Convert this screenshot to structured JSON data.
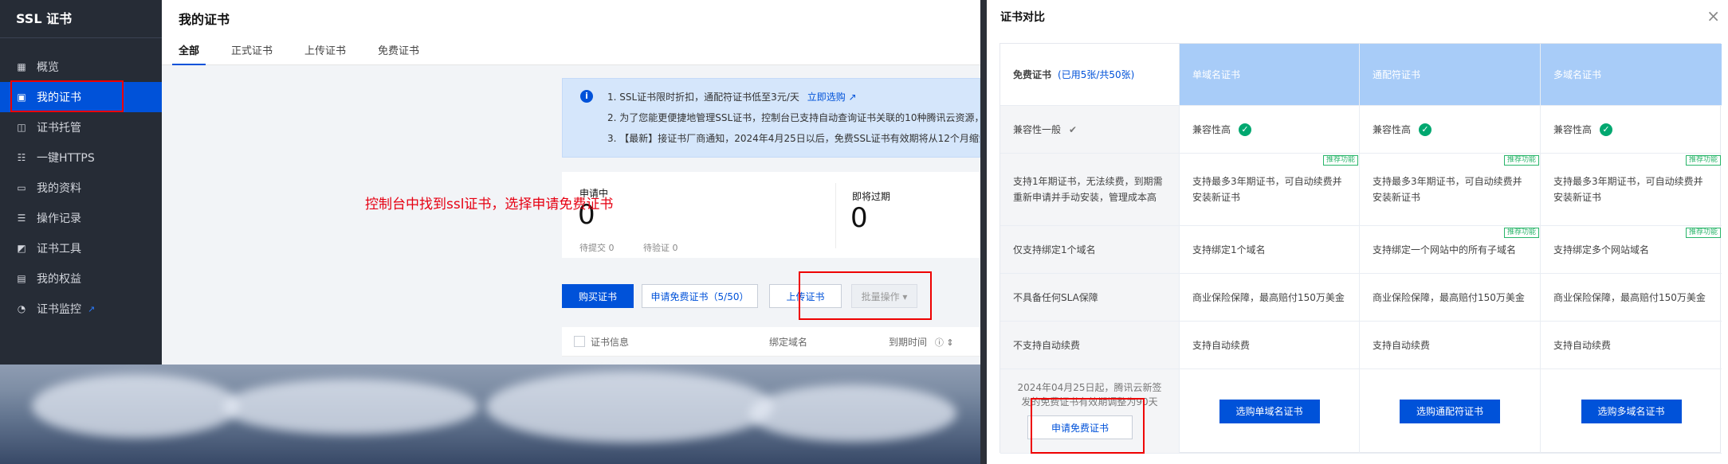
{
  "left": {
    "sidebar": {
      "brand": "SSL 证书",
      "items": [
        {
          "label": "概览",
          "icon": "grid-icon"
        },
        {
          "label": "我的证书",
          "icon": "document-icon"
        },
        {
          "label": "证书托管",
          "icon": "shield-icon"
        },
        {
          "label": "一键HTTPS",
          "icon": "bars-icon"
        },
        {
          "label": "我的资料",
          "icon": "folder-icon"
        },
        {
          "label": "操作记录",
          "icon": "list-icon"
        },
        {
          "label": "证书工具",
          "icon": "tool-icon"
        },
        {
          "label": "我的权益",
          "icon": "calendar-icon"
        },
        {
          "label": "证书监控",
          "icon": "monitor-icon",
          "external": "↗"
        }
      ]
    },
    "header": {
      "title": "我的证书",
      "tabs": [
        "全部",
        "正式证书",
        "上传证书",
        "免费证书"
      ]
    },
    "notice": {
      "lines": [
        "1. SSL证书限时折扣，通配符证书低至3元/天",
        "2. 为了您能更便捷地管理SSL证书，控制台已支持自动查询证书关联的10种腾讯云资源，",
        "3. 【最新】接证书厂商通知，2024年4月25日以后，免费SSL证书有效期将从12个月缩短至"
      ],
      "link": "立即选购 ↗"
    },
    "annotation": "控制台中找到ssl证书，选择申请免费证书",
    "stats": {
      "pending_title": "申请中",
      "pending_count": "0",
      "pending_submit": "待提交 0",
      "pending_verify": "待验证 0",
      "expiring_title": "即将过期",
      "expiring_count": "0"
    },
    "buttons": {
      "buy": "购买证书",
      "apply_free": "申请免费证书（5/50）",
      "upload": "上传证书",
      "batch": "批量操作 ▾"
    },
    "table": {
      "headers": [
        "证书信息",
        "绑定域名",
        "到期时间"
      ],
      "sort_icons": "ⓘ ⇕"
    }
  },
  "panel": {
    "title": "证书对比",
    "close": "×",
    "columns": [
      {
        "label": "免费证书",
        "sub": "(已用5张/共50张)"
      },
      {
        "label": "单域名证书"
      },
      {
        "label": "通配符证书"
      },
      {
        "label": "多域名证书"
      }
    ],
    "rows": [
      {
        "cells": [
          "兼容性一般",
          "兼容性高",
          "兼容性高",
          "兼容性高"
        ],
        "icons": [
          "tick-icon",
          "ok-icon",
          "ok-icon",
          "ok-icon"
        ]
      },
      {
        "cells": [
          "支持1年期证书，无法续费，到期需重新申请并手动安装，管理成本高",
          "支持最多3年期证书，可自动续费并安装新证书",
          "支持最多3年期证书，可自动续费并安装新证书",
          "支持最多3年期证书，可自动续费并安装新证书"
        ],
        "badges": [
          "",
          "推荐功能",
          "推荐功能",
          "推荐功能"
        ]
      },
      {
        "cells": [
          "仅支持绑定1个域名",
          "支持绑定1个域名",
          "支持绑定一个网站中的所有子域名",
          "支持绑定多个网站域名"
        ],
        "badges": [
          "",
          "",
          "推荐功能",
          "推荐功能"
        ]
      },
      {
        "cells": [
          "不具备任何SLA保障",
          "商业保险保障，最高赔付150万美金",
          "商业保险保障，最高赔付150万美金",
          "商业保险保障，最高赔付150万美金"
        ]
      },
      {
        "cells": [
          "不支持自动续费",
          "支持自动续费",
          "支持自动续费",
          "支持自动续费"
        ]
      }
    ],
    "footer": {
      "free_note": "2024年04月25日起，腾讯云新签发的免费证书有效期调整为90天",
      "free_button": "申请免费证书",
      "buy_buttons": [
        "选购单域名证书",
        "选购通配符证书",
        "选购多域名证书"
      ]
    }
  }
}
